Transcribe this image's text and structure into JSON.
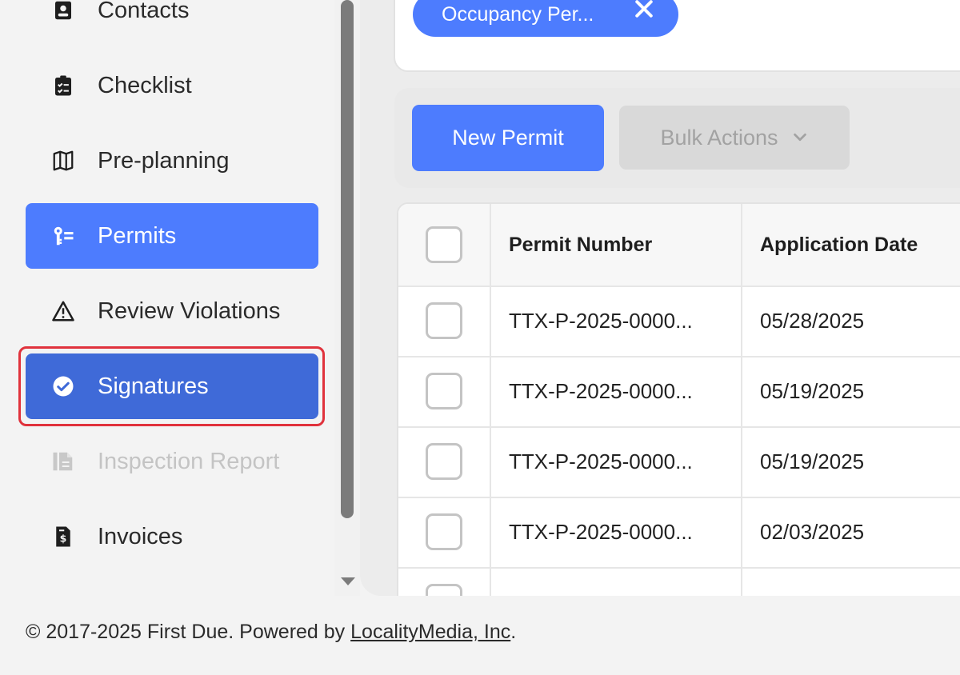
{
  "sidebar": {
    "items": [
      {
        "label": "Contacts",
        "icon": "contacts-icon"
      },
      {
        "label": "Checklist",
        "icon": "checklist-icon"
      },
      {
        "label": "Pre-planning",
        "icon": "map-icon"
      },
      {
        "label": "Permits",
        "icon": "permits-icon",
        "state": "active"
      },
      {
        "label": "Review Violations",
        "icon": "warning-icon"
      },
      {
        "label": "Signatures",
        "icon": "check-circle-icon",
        "state": "selected"
      },
      {
        "label": "Inspection Report",
        "icon": "report-icon",
        "state": "disabled"
      },
      {
        "label": "Invoices",
        "icon": "invoice-icon"
      }
    ]
  },
  "filters": {
    "chip_label": "Occupancy Per..."
  },
  "toolbar": {
    "new_label": "New Permit",
    "bulk_label": "Bulk Actions"
  },
  "table": {
    "columns": [
      "Permit Number",
      "Application Date"
    ],
    "rows": [
      {
        "permit_number": "TTX-P-2025-0000...",
        "application_date": "05/28/2025"
      },
      {
        "permit_number": "TTX-P-2025-0000...",
        "application_date": "05/19/2025"
      },
      {
        "permit_number": "TTX-P-2025-0000...",
        "application_date": "05/19/2025"
      },
      {
        "permit_number": "TTX-P-2025-0000...",
        "application_date": "02/03/2025"
      }
    ]
  },
  "footer": {
    "text": "© 2017-2025 First Due. Powered by ",
    "link_text": "LocalityMedia, Inc",
    "suffix": "."
  },
  "colors": {
    "accent": "#4d7cfe",
    "selected": "#3f6ad8",
    "highlight": "#e0323c"
  }
}
